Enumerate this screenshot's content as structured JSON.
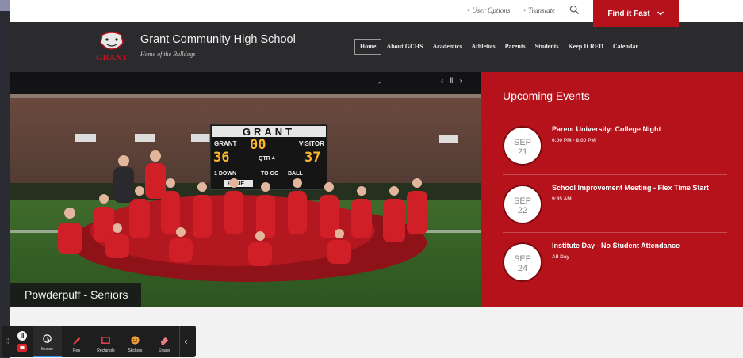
{
  "utility": {
    "user_options": "User Options",
    "translate": "Translate",
    "find_it_fast": "Find it Fast"
  },
  "header": {
    "logo_text": "GRANT",
    "school_name": "Grant Community High School",
    "tagline": "Home of the Bulldogs"
  },
  "nav": [
    {
      "label": "Home",
      "active": true
    },
    {
      "label": "About GCHS"
    },
    {
      "label": "Academics"
    },
    {
      "label": "Athletics"
    },
    {
      "label": "Parents"
    },
    {
      "label": "Students"
    },
    {
      "label": "Keep It RED"
    },
    {
      "label": "Calendar"
    }
  ],
  "hero": {
    "caption": "Powderpuff - Seniors",
    "scoreboard": {
      "brand": "GRANT",
      "home_label": "GRANT",
      "visitor_label": "VISITOR",
      "home_score": "36",
      "visitor_score": "37",
      "clock": "00",
      "qtr": "QTR 4",
      "down": "1 DOWN",
      "to_go": "TO GO",
      "ball": "BALL",
      "home_tab": "HOME"
    }
  },
  "events": {
    "title": "Upcoming Events",
    "items": [
      {
        "month": "SEP",
        "day": "21",
        "title": "Parent University: College Night",
        "time": "6:00 PM - 8:00 PM"
      },
      {
        "month": "SEP",
        "day": "22",
        "title": "School Improvement Meeting - Flex Time Start",
        "time": "9:35 AM"
      },
      {
        "month": "SEP",
        "day": "24",
        "title": "Institute Day - No Student Attendance",
        "time": "All Day"
      }
    ]
  },
  "toolbar": {
    "tools": [
      {
        "label": "Mouse",
        "icon": "cursor-icon",
        "active": true
      },
      {
        "label": "Pen",
        "icon": "pen-icon"
      },
      {
        "label": "Rectangle",
        "icon": "rectangle-icon"
      },
      {
        "label": "Stickers",
        "icon": "sticker-icon"
      },
      {
        "label": "Eraser",
        "icon": "eraser-icon"
      }
    ]
  },
  "colors": {
    "brand_red": "#b5121b",
    "header_dark": "#2b2b2e",
    "toolbar_accent": "#3a8ee6"
  }
}
